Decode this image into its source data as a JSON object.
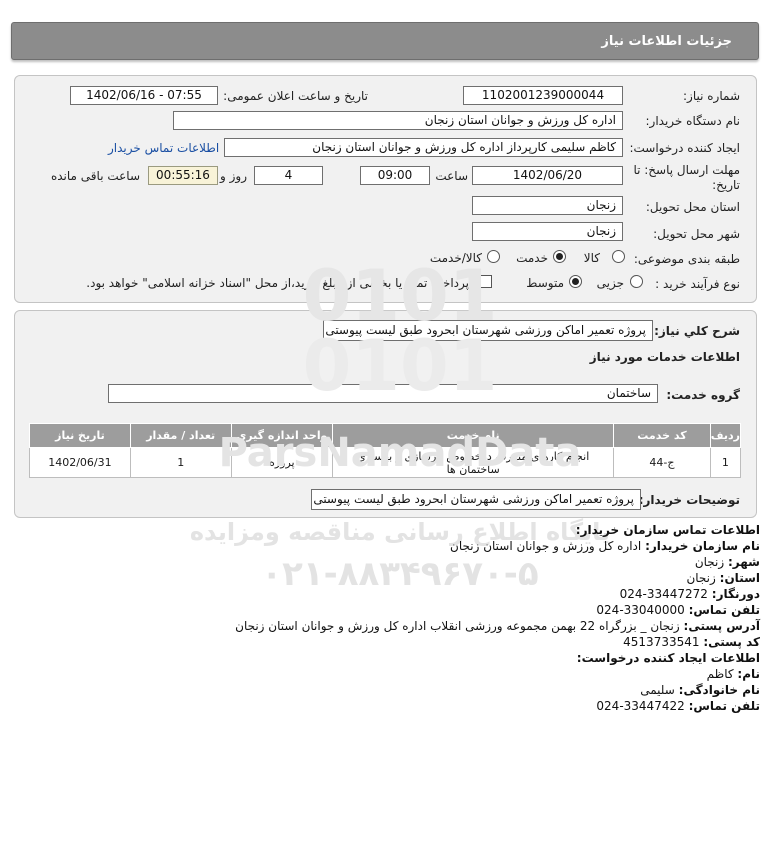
{
  "header": {
    "title": "جزئیات اطلاعات نیاز"
  },
  "form": {
    "need_number_label": "شماره نیاز:",
    "need_number": "1102001239000044",
    "announce_label": "تاریخ و ساعت اعلان عمومی:",
    "announce_value": "1402/06/16 - 07:55",
    "buyer_org_label": "نام دستگاه خریدار:",
    "buyer_org": "اداره کل ورزش و جوانان استان زنجان",
    "creator_label": "ایجاد کننده درخواست:",
    "creator": "کاظم سلیمی کارپرداز اداره کل ورزش و جوانان استان زنجان",
    "buyer_contact_link": "اطلاعات تماس خریدار",
    "deadline_label_line1": "مهلت ارسال پاسخ: تا",
    "deadline_label_line2": "تاریخ:",
    "deadline_date": "1402/06/20",
    "time_label": "ساعت",
    "deadline_time": "09:00",
    "days_value": "4",
    "days_label": "روز و",
    "remaining_time": "00:55:16",
    "remaining_label": "ساعت باقی مانده",
    "delivery_province_label": "استان محل تحویل:",
    "delivery_province": "زنجان",
    "delivery_city_label": "شهر محل تحویل:",
    "delivery_city": "زنجان",
    "category_label": "طبقه بندی موضوعی:",
    "category_options": [
      "کالا",
      "خدمت",
      "کالا/خدمت"
    ],
    "category_selected": "خدمت",
    "process_label": "نوع فرآیند خرید :",
    "process_options": [
      "جزیی",
      "متوسط"
    ],
    "process_selected": "متوسط",
    "payment_note": "پرداخت تمام یا بخشی از مبلغ خرید،از محل \"اسناد خزانه اسلامی\" خواهد بود."
  },
  "summary": {
    "description_label": "شرح کلي نياز:",
    "description": "پروژه تعمیر اماکن ورزشی شهرستان ابحرود طبق لیست پیوستی",
    "services_title": "اطلاعات خدمات مورد نیاز",
    "service_group_label": "گروه خدمت:",
    "service_group": "ساختمان"
  },
  "table": {
    "headers": [
      "ردیف",
      "کد خدمت",
      "نام خدمت",
      "واحد اندازه گیری",
      "تعداد / مقدار",
      "تاریخ نیاز"
    ],
    "rows": [
      [
        "1",
        "ج-44",
        "انجام کارهای متفرقه درخصوص بازسازی و بهسازی ساختمان ها",
        "پروژه",
        "1",
        "1402/06/31"
      ]
    ]
  },
  "buyer_notes": {
    "label": "توضیحات خریدار:",
    "value": "پروژه تعمیر اماکن ورزشی شهرستان ابحرود طبق لیست پیوستی"
  },
  "contact": {
    "org_title": "اطلاعات تماس سازمان خریدار:",
    "org_name_label": "نام سازمان خریدار:",
    "org_name": "اداره کل ورزش و جوانان استان زنجان",
    "city_label": "شهر:",
    "city": "زنجان",
    "province_label": "استان:",
    "province": "زنجان",
    "fax_label": "دورنگار:",
    "fax": "33447272-024",
    "phone_label": "تلفن تماس:",
    "phone": "33040000-024",
    "address_label": "آدرس پستی:",
    "address": "زنجان _ بزرگراه 22 بهمن مجموعه ورزشی انقلاب اداره کل ورزش و جوانان استان زنجان",
    "postal_label": "کد پستی:",
    "postal": "4513733541",
    "creator_title": "اطلاعات ایجاد کننده درخواست:",
    "first_name_label": "نام:",
    "first_name": "کاظم",
    "last_name_label": "نام خانوادگی:",
    "last_name": "سلیمی",
    "creator_phone_label": "تلفن تماس:",
    "creator_phone": "33447422-024"
  },
  "watermark": {
    "brand": "ParsNamadData",
    "line1": "پایگاه اطلاع رسانی مناقصه ومزایده",
    "line2": "۰۲۱-۸۸۳۴۹۶۷۰-۵"
  },
  "colors": {
    "header_bg": "#8c8c8c",
    "panel_bg": "#f1f1f1",
    "link": "#1a4fa3",
    "table_header_bg": "#9d9d9d"
  }
}
